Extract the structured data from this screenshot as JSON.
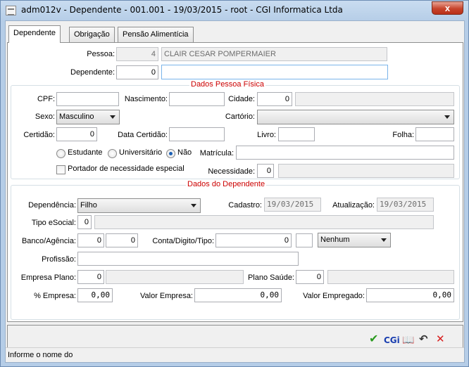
{
  "window": {
    "title": "adm012v - Dependente - 001.001 - 19/03/2015 - root - CGI Informatica Ltda",
    "close_glyph": "x"
  },
  "tabs": [
    {
      "label": "Dependente"
    },
    {
      "label": "Obrigação"
    },
    {
      "label": "Pensão Alimentícia"
    }
  ],
  "header": {
    "pessoa_label": "Pessoa:",
    "pessoa_code": "4",
    "pessoa_name": "CLAIR CESAR POMPERMAIER",
    "dependente_label": "Dependente:",
    "dependente_code": "0",
    "dependente_name": ""
  },
  "pessoa_fisica": {
    "legend": "Dados Pessoa Física",
    "cpf_label": "CPF:",
    "cpf_value": "",
    "nascimento_label": "Nascimento:",
    "nascimento_value": "",
    "cidade_label": "Cidade:",
    "cidade_code": "0",
    "cidade_name": "",
    "sexo_label": "Sexo:",
    "sexo_value": "Masculino",
    "cartorio_label": "Cartório:",
    "cartorio_value": "",
    "certidao_label": "Certidão:",
    "certidao_value": "0",
    "data_certidao_label": "Data Certidão:",
    "data_certidao_value": "",
    "livro_label": "Livro:",
    "livro_value": "",
    "folha_label": "Folha:",
    "folha_value": "",
    "radio_estudante": "Estudante",
    "radio_universitario": "Universitário",
    "radio_nao": "Não",
    "radio_selected": "Não",
    "matricula_label": "Matrícula:",
    "matricula_value": "",
    "portador_label": "Portador de necessidade especial",
    "portador_checked": false,
    "necessidade_label": "Necessidade:",
    "necessidade_code": "0",
    "necessidade_name": ""
  },
  "dados_dependente": {
    "legend": "Dados do Dependente",
    "dependencia_label": "Dependência:",
    "dependencia_value": "Filho",
    "cadastro_label": "Cadastro:",
    "cadastro_value": "19/03/2015",
    "atualizacao_label": "Atualização:",
    "atualizacao_value": "19/03/2015",
    "tipo_esocial_label": "Tipo eSocial:",
    "tipo_esocial_code": "0",
    "tipo_esocial_name": "",
    "banco_label": "Banco/Agência:",
    "banco_value": "0",
    "agencia_value": "0",
    "conta_label": "Conta/Digito/Tipo:",
    "conta_value": "0",
    "digito_value": "",
    "tipo_value": "Nenhum",
    "profissao_label": "Profissão:",
    "profissao_value": "",
    "empresa_plano_label": "Empresa Plano:",
    "empresa_plano_code": "0",
    "empresa_plano_name": "",
    "plano_saude_label": "Plano Saúde:",
    "plano_saude_code": "0",
    "plano_saude_name": "",
    "pct_empresa_label": "% Empresa:",
    "pct_empresa_value": "0,00",
    "valor_empresa_label": "Valor Empresa:",
    "valor_empresa_value": "0,00",
    "valor_empregado_label": "Valor Empregado:",
    "valor_empregado_value": "0,00"
  },
  "actions": {
    "confirm_glyph": "✔",
    "cgi_label": "CGi",
    "help_glyph": "📖",
    "undo_glyph": "↶",
    "cancel_glyph": "✕"
  },
  "status": {
    "text": "Informe o nome do"
  },
  "colors": {
    "legend": "#cc0000",
    "confirm": "#2a9a1f",
    "cancel": "#d81e1e",
    "cgi": "#1b3fb0"
  }
}
